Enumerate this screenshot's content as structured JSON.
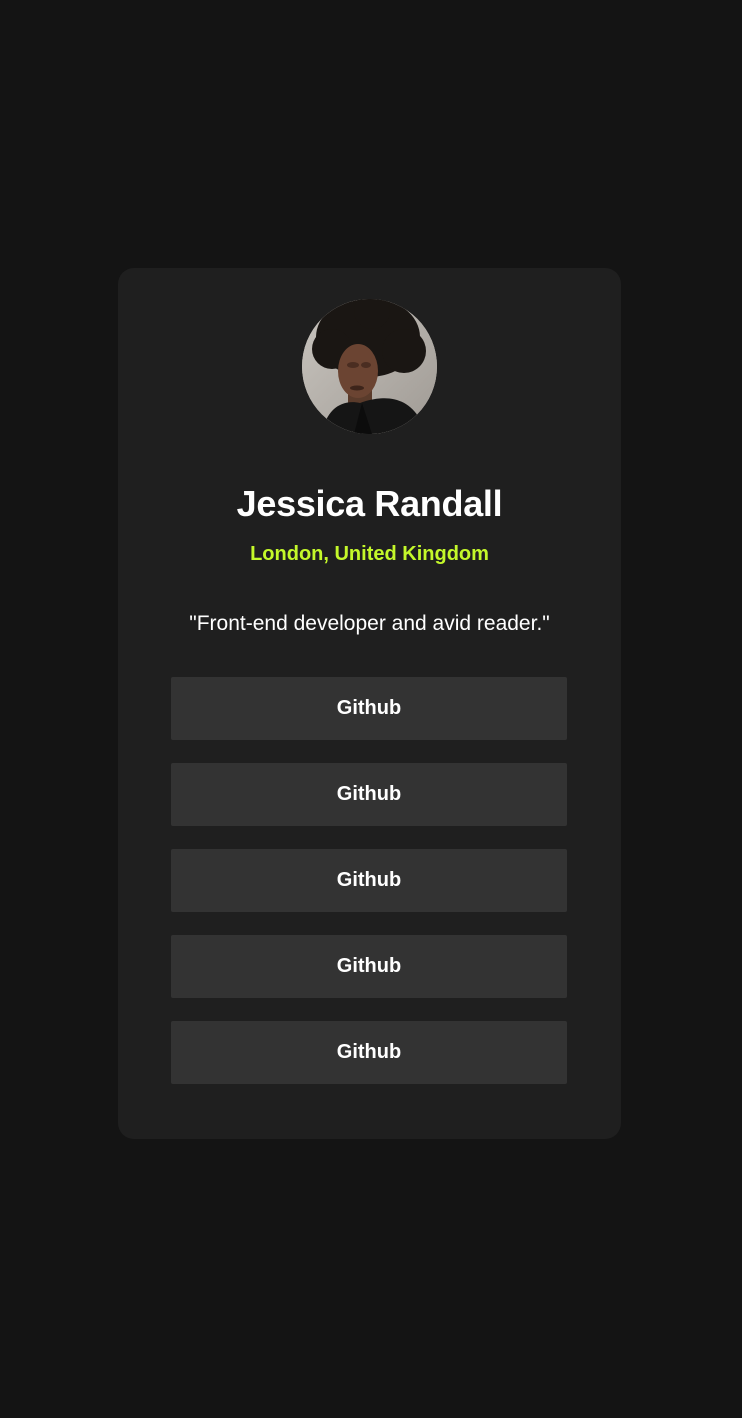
{
  "profile": {
    "avatar_icon": "profile-photo",
    "name": "Jessica Randall",
    "location": "London, United Kingdom",
    "bio": "\"Front-end developer and avid reader.\""
  },
  "links": [
    {
      "label": "Github"
    },
    {
      "label": "Github"
    },
    {
      "label": "Github"
    },
    {
      "label": "Github"
    },
    {
      "label": "Github"
    }
  ],
  "colors": {
    "page_background": "#141414",
    "card_background": "#1f1f1f",
    "button_background": "#333333",
    "accent": "#c4f82a",
    "text": "#ffffff"
  }
}
